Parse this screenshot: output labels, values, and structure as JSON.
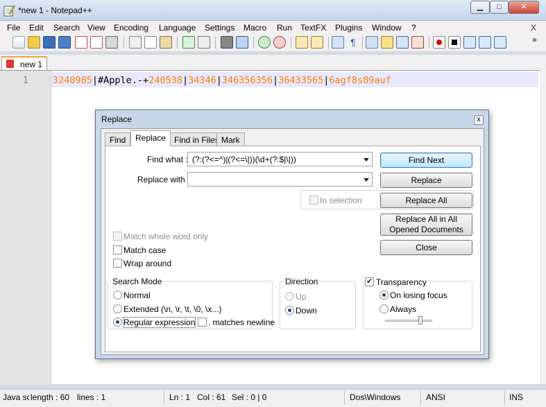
{
  "window": {
    "title": "*new  1 - Notepad++",
    "min_glyph": "▁",
    "max_glyph": "□",
    "close_glyph": "✕"
  },
  "menu": {
    "items": [
      "File",
      "Edit",
      "Search",
      "View",
      "Encoding",
      "Language",
      "Settings",
      "Macro",
      "Run",
      "TextFX",
      "Plugins",
      "Window",
      "?"
    ],
    "close_x": "X"
  },
  "toolbar": {
    "overflow": "»",
    "icons": [
      "new-file-icon",
      "open-file-icon",
      "save-icon",
      "save-all-icon",
      "close-icon",
      "close-all-icon",
      "print-icon",
      "cut-icon",
      "copy-icon",
      "paste-icon",
      "undo-icon",
      "redo-icon",
      "find-icon",
      "replace-icon",
      "zoom-in-icon",
      "zoom-out-icon",
      "sync-vertical-icon",
      "sync-horizontal-icon",
      "word-wrap-icon",
      "show-all-chars-icon",
      "indent-guide-icon",
      "user-lang-icon",
      "doc-map-icon",
      "function-list-icon",
      "record-macro-icon",
      "stop-macro-icon",
      "play-macro-icon",
      "run-macro-multiple-icon",
      "save-macro-icon"
    ]
  },
  "tab": {
    "label": "new  1"
  },
  "editor": {
    "line_number": "1",
    "tokens": [
      {
        "t": "3240985",
        "k": "num"
      },
      {
        "t": "|#Apple.-+",
        "k": "op"
      },
      {
        "t": "240538",
        "k": "num"
      },
      {
        "t": "|",
        "k": "op"
      },
      {
        "t": "34346",
        "k": "num"
      },
      {
        "t": "|",
        "k": "op"
      },
      {
        "t": "346356356",
        "k": "num"
      },
      {
        "t": "|",
        "k": "op"
      },
      {
        "t": "36433565",
        "k": "num"
      },
      {
        "t": "|",
        "k": "op"
      },
      {
        "t": "6agf8s89auf",
        "k": "num"
      }
    ],
    "number_color": "#ff8000",
    "current_line_color": "#e8e8ff"
  },
  "status": {
    "lang": "Java sc",
    "length": "length : 60",
    "lines": "lines : 1",
    "ln": "Ln : 1",
    "col": "Col : 61",
    "sel": "Sel : 0 | 0",
    "eol": "Dos\\Windows",
    "encoding": "ANSI",
    "mode": "INS"
  },
  "dialog": {
    "title": "Replace",
    "close": "x",
    "tabs": [
      "Find",
      "Replace",
      "Find in Files",
      "Mark"
    ],
    "find_label": "Find what :",
    "find_value": "(?:(?<=^)|(?<=\\|))(\\d+(?:$|\\|))",
    "replace_label": "Replace with :",
    "replace_value": "",
    "in_selection": "In selection",
    "buttons": {
      "find_next": "Find Next",
      "replace": "Replace",
      "replace_all": "Replace All",
      "replace_all_opened": "Replace All in All Opened Documents",
      "close": "Close"
    },
    "options": {
      "match_whole_word": "Match whole word only",
      "match_case": "Match case",
      "wrap_around": "Wrap around"
    },
    "search_mode": {
      "title": "Search Mode",
      "normal": "Normal",
      "extended": "Extended (\\n, \\r, \\t, \\0, \\x...)",
      "regex": "Regular expression",
      "matches_newline": ". matches newline"
    },
    "direction": {
      "title": "Direction",
      "up": "Up",
      "down": "Down"
    },
    "transparency": {
      "title": "Transparency",
      "on_losing_focus": "On losing focus",
      "always": "Always",
      "level": 0.75
    }
  }
}
